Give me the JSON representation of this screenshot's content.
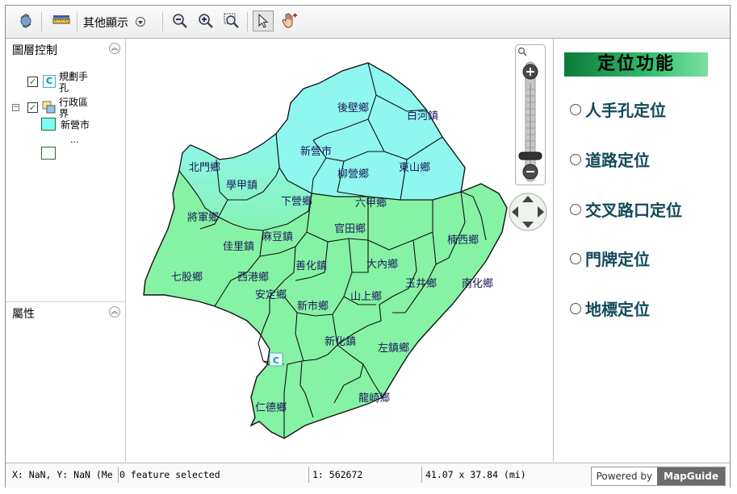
{
  "toolbar": {
    "other_display": "其他顯示"
  },
  "layer_panel": {
    "title": "圖層控制",
    "layers": [
      {
        "label_line1": "規劃手",
        "label_line2": "孔"
      },
      {
        "label_line1": "行政區",
        "label_line2": "界"
      }
    ],
    "legend_label": "新營市",
    "legend_more": "...",
    "colors": {
      "fill": "#7ff8f8",
      "fill2": "#ffffff"
    }
  },
  "properties_panel": {
    "title": "屬性"
  },
  "map": {
    "colors": {
      "cyan": "#8ff7ee",
      "green": "#86f2a4",
      "border": "#111111"
    },
    "towns": [
      "後壁鄉",
      "白河鎮",
      "新營市",
      "柳營鄉",
      "東山鄉",
      "北門鄉",
      "學甲鎮",
      "下營鄉",
      "六甲鄉",
      "將軍鄉",
      "麻豆鎮",
      "官田鄉",
      "楠西鄉",
      "佳里鎮",
      "七股鄉",
      "西港鄉",
      "善化鎮",
      "大內鄉",
      "玉井鄉",
      "南化鄉",
      "安定鄉",
      "新市鄉",
      "山上鄉",
      "新化鎮",
      "左鎮鄉",
      "仁德鄉",
      "龍崎鄉"
    ],
    "marker": "C"
  },
  "locate_panel": {
    "title": "定位功能",
    "options": [
      "人手孔定位",
      "道路定位",
      "交叉路口定位",
      "門牌定位",
      "地標定位"
    ]
  },
  "status": {
    "coords": "X: NaN, Y: NaN (Me",
    "selection": "0 feature selected",
    "scale": "1: 562672",
    "extent": "41.07 x 37.84 (mi)",
    "powered_by": "Powered by",
    "brand": "MapGuide"
  }
}
